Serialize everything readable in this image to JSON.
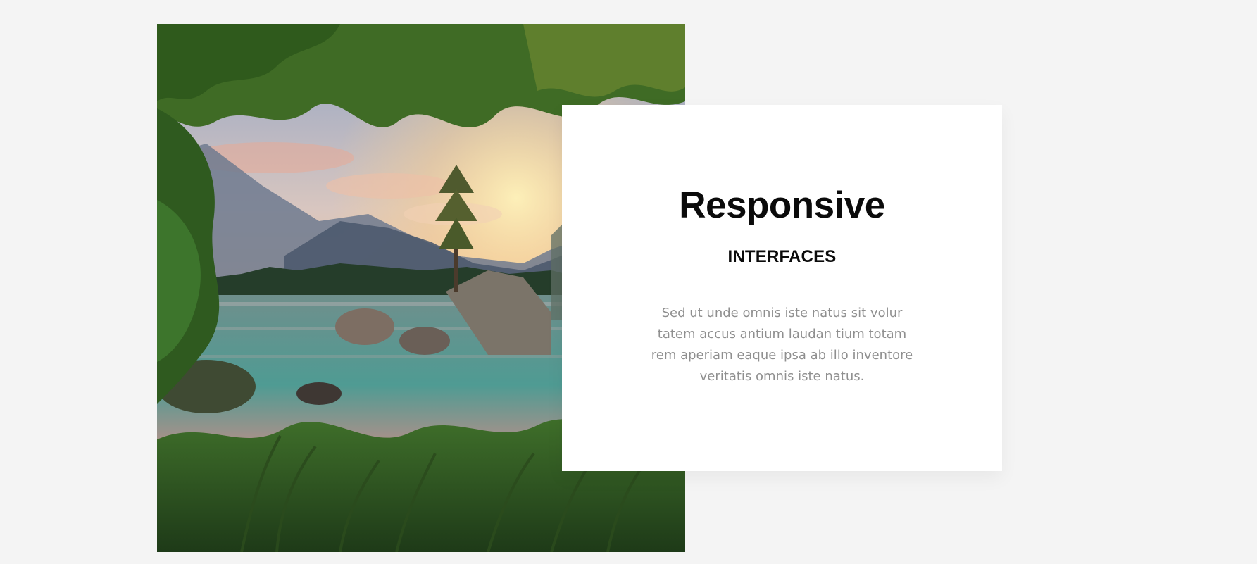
{
  "hero_image": {
    "icon": "landscape-lake-sunset-photo"
  },
  "card": {
    "title": "Responsive",
    "subtitle": "INTERFACES",
    "body": "Sed ut unde omnis iste natus sit volur tatem accus antium laudan tium totam rem aperiam eaque ipsa ab illo inventore veritatis omnis iste natus."
  },
  "colors": {
    "page_background": "#f4f4f4",
    "card_background": "#ffffff",
    "title_text": "#0b0b0b",
    "body_text": "#8f8f8f"
  }
}
